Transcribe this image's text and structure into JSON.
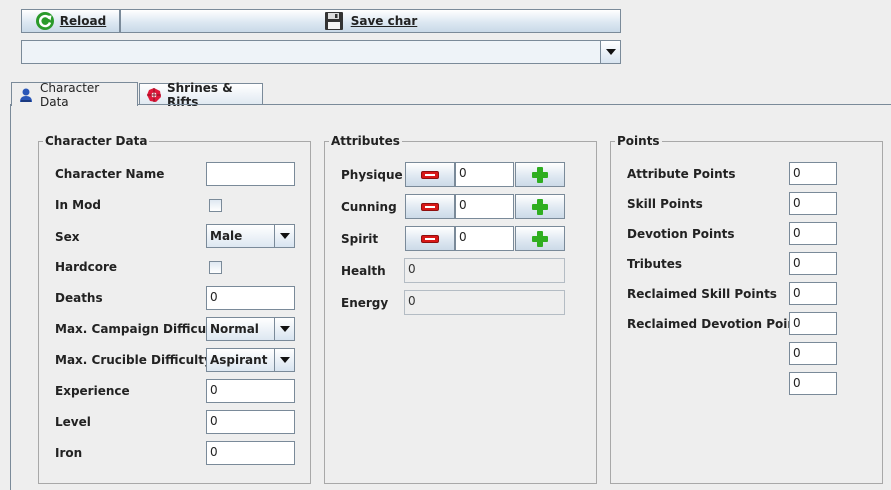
{
  "toolbar": {
    "reload_label": "Reload",
    "save_label": "Save char",
    "character_select_value": ""
  },
  "tabs": [
    {
      "label": "Character Data",
      "icon": "user-icon"
    },
    {
      "label": "Shrines & Rifts",
      "icon": "shrine-icon"
    }
  ],
  "character": {
    "title": "Character Data",
    "name_label": "Character Name",
    "name_value": "",
    "inmod_label": "In Mod",
    "sex_label": "Sex",
    "sex_value": "Male",
    "hardcore_label": "Hardcore",
    "deaths_label": "Deaths",
    "deaths_value": "0",
    "campaign_label": "Max. Campaign Difficulty",
    "campaign_value": "Normal",
    "crucible_label": "Max. Crucible Difficulty",
    "crucible_value": "Aspirant",
    "experience_label": "Experience",
    "experience_value": "0",
    "level_label": "Level",
    "level_value": "0",
    "iron_label": "Iron",
    "iron_value": "0"
  },
  "attributes": {
    "title": "Attributes",
    "physique_label": "Physique",
    "physique_value": "0",
    "cunning_label": "Cunning",
    "cunning_value": "0",
    "spirit_label": "Spirit",
    "spirit_value": "0",
    "health_label": "Health",
    "health_value": "0",
    "energy_label": "Energy",
    "energy_value": "0"
  },
  "points": {
    "title": "Points",
    "attribute_label": "Attribute Points",
    "attribute_value": "0",
    "skill_label": "Skill Points",
    "skill_value": "0",
    "devotion_label": "Devotion Points",
    "devotion_value": "0",
    "tributes_label": "Tributes",
    "tributes_value": "0",
    "reclaimed_skill_label": "Reclaimed Skill Points",
    "reclaimed_skill_value": "0",
    "reclaimed_devotion_label": "Reclaimed Devotion Points",
    "reclaimed_devotion_value": "0",
    "extra1_value": "0",
    "extra2_value": "0"
  }
}
